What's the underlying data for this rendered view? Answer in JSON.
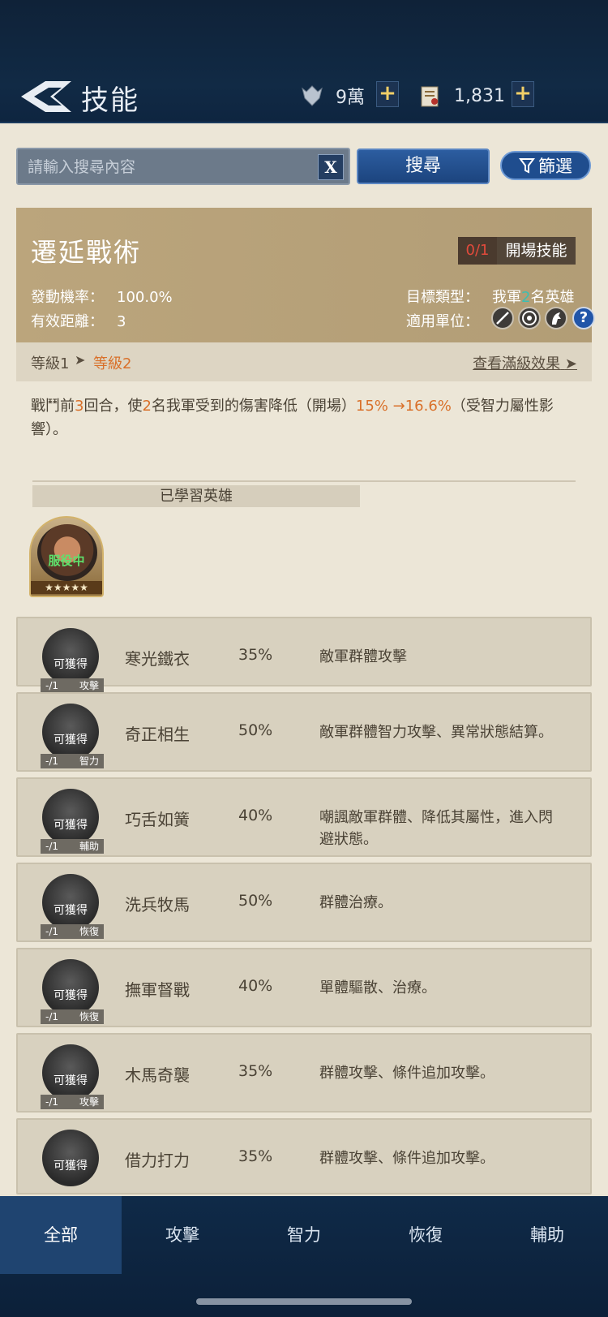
{
  "header": {
    "title": "技能",
    "resource1": {
      "icon": "troops-icon",
      "value": "9萬"
    },
    "resource2": {
      "icon": "scroll-icon",
      "value": "1,831"
    },
    "plus": "+"
  },
  "search": {
    "placeholder": "請輸入搜尋內容",
    "clear_label": "X",
    "button_label": "搜尋",
    "filter_label": "篩選"
  },
  "skill": {
    "name": "遷延戰術",
    "count": "0/1",
    "type": "開場技能",
    "trigger_label": "發動機率：",
    "trigger_value": "100.0%",
    "range_label": "有效距離：",
    "range_value": "3",
    "target_label": "目標類型：",
    "target_pre": "我軍",
    "target_num": "2",
    "target_post": "名英雄",
    "units_label": "適用單位：",
    "units": [
      "sword-icon",
      "target-icon",
      "cavalry-icon",
      "help-icon"
    ],
    "help_glyph": "?",
    "level1": "等級1",
    "arrow": "➤",
    "level2": "等級2",
    "full_effect": "查看滿級效果",
    "desc": {
      "p1": "戰鬥前",
      "n1": "3",
      "p2": "回合，使",
      "n2": "2",
      "p3": "名我軍受到的傷害降低（開場）",
      "n3": "15% →16.6%",
      "p4": "（受智力屬性影響）。"
    },
    "learned_label": "已學習英雄",
    "hero": {
      "status": "服役中",
      "stars": "★★★★★"
    }
  },
  "list": [
    {
      "obtain": "可獲得",
      "slot": "-/1",
      "category": "攻擊",
      "name": "寒光鐵衣",
      "rate": "35%",
      "desc": "敵軍群體攻擊"
    },
    {
      "obtain": "可獲得",
      "slot": "-/1",
      "category": "智力",
      "name": "奇正相生",
      "rate": "50%",
      "desc": "敵軍群體智力攻擊、異常狀態結算。"
    },
    {
      "obtain": "可獲得",
      "slot": "-/1",
      "category": "輔助",
      "name": "巧舌如簧",
      "rate": "40%",
      "desc": "嘲諷敵軍群體、降低其屬性，進入閃避狀態。"
    },
    {
      "obtain": "可獲得",
      "slot": "-/1",
      "category": "恢復",
      "name": "洗兵牧馬",
      "rate": "50%",
      "desc": "群體治療。"
    },
    {
      "obtain": "可獲得",
      "slot": "-/1",
      "category": "恢復",
      "name": "撫軍督戰",
      "rate": "40%",
      "desc": "單體驅散、治療。"
    },
    {
      "obtain": "可獲得",
      "slot": "-/1",
      "category": "攻擊",
      "name": "木馬奇襲",
      "rate": "35%",
      "desc": "群體攻擊、條件追加攻擊。"
    },
    {
      "obtain": "可獲得",
      "slot": "",
      "category": "",
      "name": "借力打力",
      "rate": "35%",
      "desc": "群體攻擊、條件追加攻擊。"
    }
  ],
  "tabs": [
    "全部",
    "攻擊",
    "智力",
    "恢復",
    "輔助"
  ],
  "colors": {
    "accent_orange": "#d9702a",
    "teal": "#3bbfb3",
    "header_bg": "#112a45",
    "active_tab": "#1f4470"
  }
}
